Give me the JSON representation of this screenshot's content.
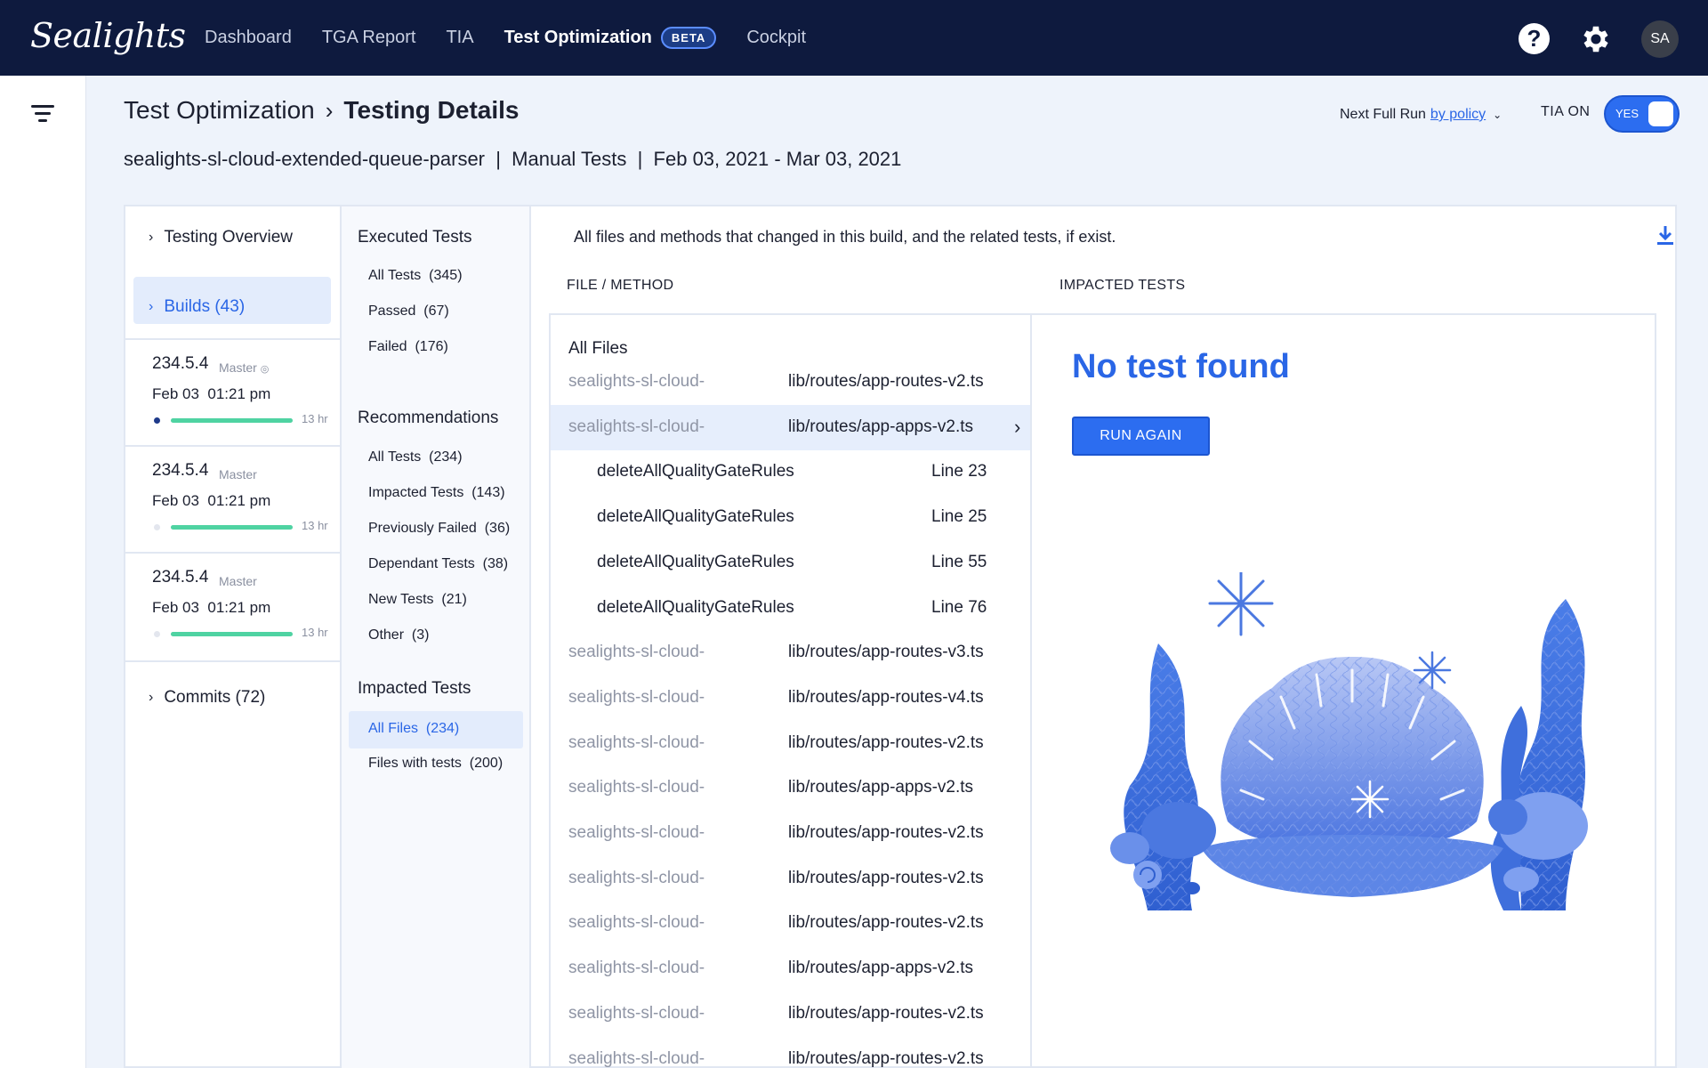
{
  "app": {
    "logo": "Sealights",
    "nav": [
      {
        "label": "Dashboard",
        "active": false
      },
      {
        "label": "TGA Report",
        "active": false
      },
      {
        "label": "TIA",
        "active": false
      },
      {
        "label": "Test Optimization",
        "active": true,
        "badge": "BETA"
      },
      {
        "label": "Cockpit",
        "active": false
      }
    ],
    "help_glyph": "?",
    "avatar_initials": "SA"
  },
  "header": {
    "breadcrumb_parent": "Test Optimization",
    "breadcrumb_current": "Testing Details",
    "subtitle": "sealights-sl-cloud-extended-queue-parser  |  Manual Tests  |  Feb 03, 2021 - Mar 03, 2021",
    "next_run_label": "Next Full Run",
    "next_run_link": "by policy",
    "tia_label": "TIA ON",
    "tia_toggle": "YES"
  },
  "left": {
    "overview_label": "Testing Overview",
    "builds_label": "Builds (43)",
    "builds": [
      {
        "version": "234.5.4",
        "branch": "Master",
        "date": "Feb 03  01:21 pm",
        "duration": "13 hr",
        "progress": 1.0,
        "dot_color": "#1e3a8a"
      },
      {
        "version": "234.5.4",
        "branch": "Master",
        "date": "Feb 03  01:21 pm",
        "duration": "13 hr",
        "progress": 1.0,
        "dot_color": "#e3e6ee"
      },
      {
        "version": "234.5.4",
        "branch": "Master",
        "date": "Feb 03  01:21 pm",
        "duration": "13 hr",
        "progress": 1.0,
        "dot_color": "#e3e6ee"
      }
    ],
    "commits_label": "Commits (72)"
  },
  "middle": {
    "executed_title": "Executed Tests",
    "executed": [
      "All Tests  (345)",
      "Passed  (67)",
      "Failed  (176)"
    ],
    "recommendations_title": "Recommendations",
    "recommendations": [
      "All Tests  (234)",
      "Impacted Tests  (143)",
      "Previously Failed  (36)",
      "Dependant Tests  (38)",
      "New Tests  (21)",
      "Other  (3)"
    ],
    "impacted_title": "Impacted Tests",
    "impacted": [
      "All Files  (234)",
      "Files with tests  (200)"
    ]
  },
  "main": {
    "description": "All files and methods that changed in this build, and the related tests, if exist.",
    "col_file": "FILE / METHOD",
    "col_tests": "IMPACTED TESTS",
    "all_files": "All Files",
    "rows": [
      {
        "type": "file",
        "repo": "sealights-sl-cloud-",
        "path": "lib/routes/app-routes-v2.ts"
      },
      {
        "type": "file",
        "repo": "sealights-sl-cloud-",
        "path": "lib/routes/app-apps-v2.ts",
        "selected": true
      },
      {
        "type": "method",
        "method": "deleteAllQualityGateRules",
        "line": "Line 23"
      },
      {
        "type": "method",
        "method": "deleteAllQualityGateRules",
        "line": "Line 25"
      },
      {
        "type": "method",
        "method": "deleteAllQualityGateRules",
        "line": "Line 55"
      },
      {
        "type": "method",
        "method": "deleteAllQualityGateRules",
        "line": "Line 76"
      },
      {
        "type": "file",
        "repo": "sealights-sl-cloud-",
        "path": "lib/routes/app-routes-v3.ts"
      },
      {
        "type": "file",
        "repo": "sealights-sl-cloud-",
        "path": "lib/routes/app-routes-v4.ts"
      },
      {
        "type": "file",
        "repo": "sealights-sl-cloud-",
        "path": "lib/routes/app-routes-v2.ts"
      },
      {
        "type": "file",
        "repo": "sealights-sl-cloud-",
        "path": "lib/routes/app-apps-v2.ts"
      },
      {
        "type": "file",
        "repo": "sealights-sl-cloud-",
        "path": "lib/routes/app-routes-v2.ts"
      },
      {
        "type": "file",
        "repo": "sealights-sl-cloud-",
        "path": "lib/routes/app-routes-v2.ts"
      },
      {
        "type": "file",
        "repo": "sealights-sl-cloud-",
        "path": "lib/routes/app-routes-v2.ts"
      },
      {
        "type": "file",
        "repo": "sealights-sl-cloud-",
        "path": "lib/routes/app-apps-v2.ts"
      },
      {
        "type": "file",
        "repo": "sealights-sl-cloud-",
        "path": "lib/routes/app-routes-v2.ts"
      },
      {
        "type": "file",
        "repo": "sealights-sl-cloud-",
        "path": "lib/routes/app-routes-v2.ts"
      }
    ],
    "no_test": "No test found",
    "run_again": "RUN AGAIN",
    "accent": "#2a66e6"
  },
  "icons": {
    "filter": "filter-icon",
    "help": "help-icon",
    "settings": "gear-icon",
    "download": "download-icon",
    "chevron": "chevron-right-icon",
    "illustration": "seashell-illustration"
  }
}
